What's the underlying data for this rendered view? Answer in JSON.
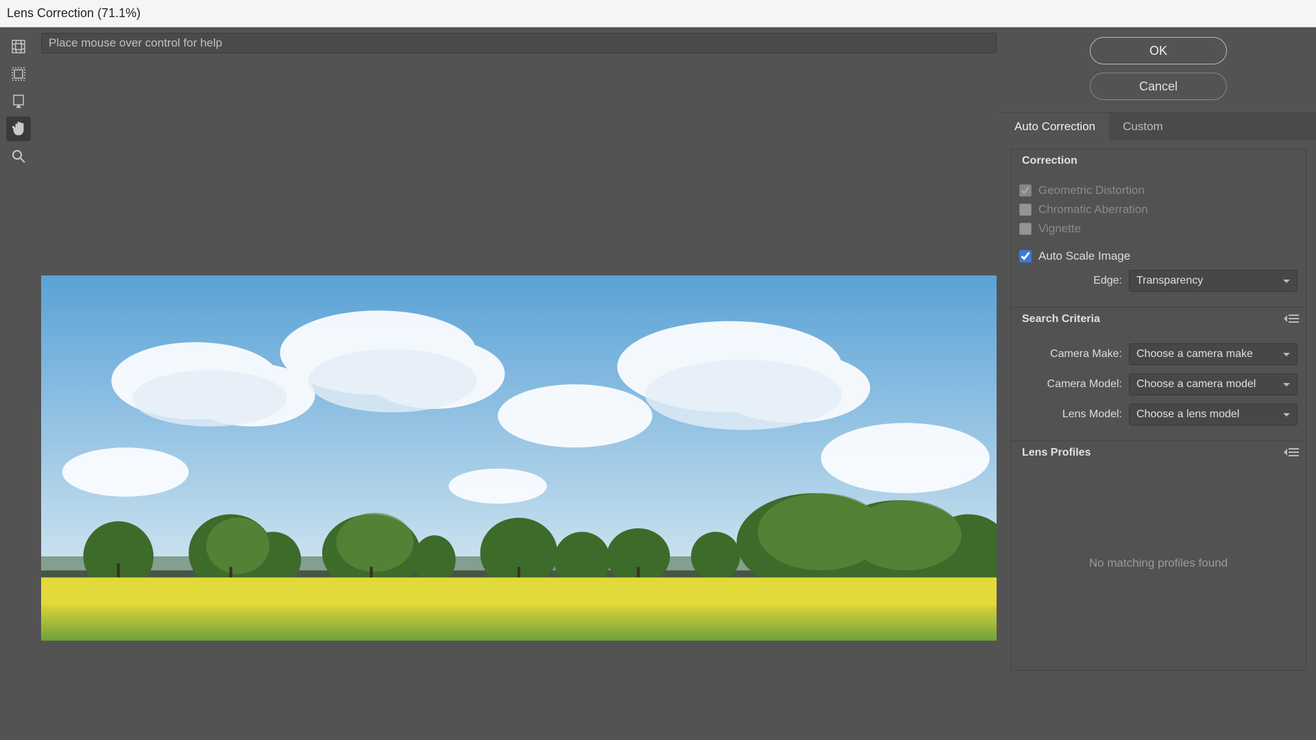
{
  "window": {
    "title": "Lens Correction (71.1%)"
  },
  "helpbar": {
    "text": "Place mouse over control for help"
  },
  "buttons": {
    "ok": "OK",
    "cancel": "Cancel"
  },
  "tabs": {
    "auto": "Auto Correction",
    "custom": "Custom"
  },
  "correction": {
    "title": "Correction",
    "geometric": "Geometric Distortion",
    "chromatic": "Chromatic Aberration",
    "vignette": "Vignette",
    "autoscale": "Auto Scale Image",
    "edge_label": "Edge:",
    "edge_value": "Transparency"
  },
  "search": {
    "title": "Search Criteria",
    "make_label": "Camera Make:",
    "make_value": "Choose a camera make",
    "model_label": "Camera Model:",
    "model_value": "Choose a camera model",
    "lens_label": "Lens Model:",
    "lens_value": "Choose a lens model"
  },
  "profiles": {
    "title": "Lens Profiles",
    "empty": "No matching profiles found"
  },
  "tools": [
    "remove-distortion",
    "straighten",
    "move-grid",
    "hand",
    "zoom"
  ]
}
